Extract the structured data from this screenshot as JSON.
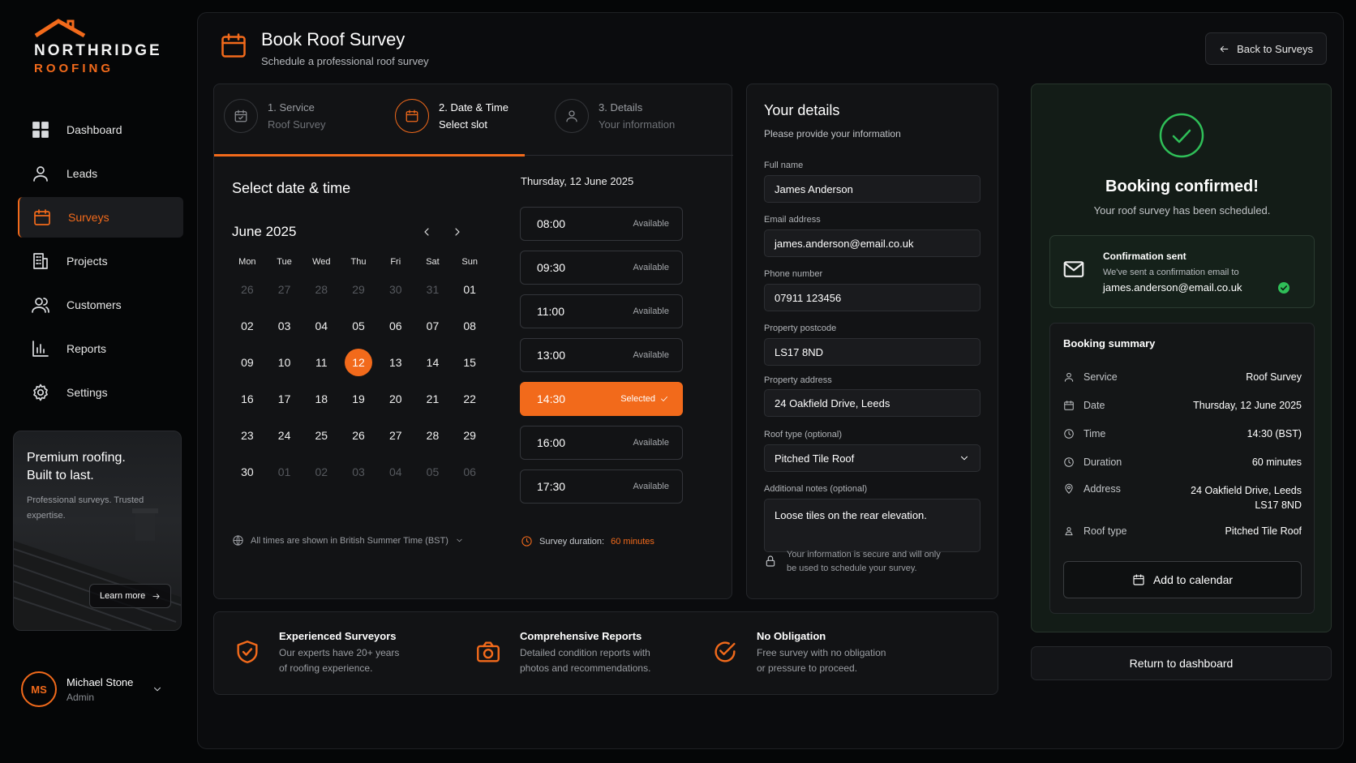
{
  "brand": {
    "name_line1": "NORTHRIDGE",
    "name_line2": "ROOFING"
  },
  "nav": [
    {
      "label": "Dashboard",
      "icon": "grid-icon"
    },
    {
      "label": "Leads",
      "icon": "user-icon"
    },
    {
      "label": "Surveys",
      "icon": "calendar-icon",
      "active": true
    },
    {
      "label": "Projects",
      "icon": "building-icon"
    },
    {
      "label": "Customers",
      "icon": "users-icon"
    },
    {
      "label": "Reports",
      "icon": "bar-chart-icon"
    },
    {
      "label": "Settings",
      "icon": "gear-icon"
    }
  ],
  "promo": {
    "heading": "Premium roofing. Built to last.",
    "text": "Professional surveys. Trusted expertise.",
    "button": "Learn more"
  },
  "user": {
    "initials": "MS",
    "name": "Michael Stone",
    "role": "Admin"
  },
  "header": {
    "title": "Book Roof Survey",
    "subtitle": "Schedule a professional roof survey",
    "back": "Back to Surveys"
  },
  "steps": [
    {
      "title": "1. Service",
      "sub": "Roof Survey"
    },
    {
      "title": "2. Date & Time",
      "sub": "Select slot",
      "active": true
    },
    {
      "title": "3. Details",
      "sub": "Your information"
    }
  ],
  "calendar": {
    "heading": "Select date & time",
    "month": "June 2025",
    "weekdays": [
      "Mon",
      "Tue",
      "Wed",
      "Thu",
      "Fri",
      "Sat",
      "Sun"
    ],
    "weeks": [
      [
        "26",
        "27",
        "28",
        "29",
        "30",
        "31",
        "01"
      ],
      [
        "02",
        "03",
        "04",
        "05",
        "06",
        "07",
        "08"
      ],
      [
        "09",
        "10",
        "11",
        "12",
        "13",
        "14",
        "15"
      ],
      [
        "16",
        "17",
        "18",
        "19",
        "20",
        "21",
        "22"
      ],
      [
        "23",
        "24",
        "25",
        "26",
        "27",
        "28",
        "29"
      ],
      [
        "30",
        "01",
        "02",
        "03",
        "04",
        "05",
        "06"
      ]
    ],
    "muted_first_row": 6,
    "muted_last_row_from": 1,
    "selected": "12",
    "timezone_note": "All times are shown in British Summer Time (BST)"
  },
  "slots": {
    "date_label": "Thursday, 12 June 2025",
    "items": [
      {
        "time": "08:00",
        "status": "Available"
      },
      {
        "time": "09:30",
        "status": "Available"
      },
      {
        "time": "11:00",
        "status": "Available"
      },
      {
        "time": "13:00",
        "status": "Available"
      },
      {
        "time": "14:30",
        "status": "Selected",
        "selected": true
      },
      {
        "time": "16:00",
        "status": "Available"
      },
      {
        "time": "17:30",
        "status": "Available"
      }
    ],
    "duration_label": "Survey duration:",
    "duration_value": "60 minutes"
  },
  "details": {
    "title": "Your details",
    "subtitle": "Please provide your information",
    "full_name_label": "Full name",
    "full_name": "James Anderson",
    "email_label": "Email address",
    "email": "james.anderson@email.co.uk",
    "phone_label": "Phone number",
    "phone": "07911 123456",
    "postcode_label": "Property postcode",
    "postcode": "LS17 8ND",
    "address_label": "Property address",
    "address": "24 Oakfield Drive, Leeds",
    "roof_label": "Roof type (optional)",
    "roof": "Pitched Tile Roof",
    "notes_label": "Additional notes (optional)",
    "notes": "Loose tiles on the rear elevation.",
    "secure_line1": "Your information is secure and will only",
    "secure_line2": "be used to schedule your survey."
  },
  "confirmation": {
    "title": "Booking confirmed!",
    "subtitle": "Your roof survey has been scheduled.",
    "sent_title": "Confirmation sent",
    "sent_text": "We've sent a confirmation email to",
    "sent_email": "james.anderson@email.co.uk",
    "summary_title": "Booking summary",
    "summary": {
      "service_k": "Service",
      "service_v": "Roof Survey",
      "date_k": "Date",
      "date_v": "Thursday, 12 June 2025",
      "time_k": "Time",
      "time_v": "14:30 (BST)",
      "duration_k": "Duration",
      "duration_v": "60 minutes",
      "address_k": "Address",
      "address_v1": "24 Oakfield Drive, Leeds",
      "address_v2": "LS17 8ND",
      "roof_k": "Roof type",
      "roof_v": "Pitched Tile Roof"
    },
    "add_calendar": "Add to calendar",
    "return": "Return to dashboard",
    "success_color": "#2fbf58"
  },
  "features": [
    {
      "title": "Experienced Surveyors",
      "line1": "Our experts have 20+ years",
      "line2": "of roofing experience.",
      "icon": "shield-check-icon"
    },
    {
      "title": "Comprehensive Reports",
      "line1": "Detailed condition reports with",
      "line2": "photos and recommendations.",
      "icon": "camera-icon"
    },
    {
      "title": "No Obligation",
      "line1": "Free survey with no obligation",
      "line2": "or pressure to proceed.",
      "icon": "check-circle-icon"
    }
  ],
  "colors": {
    "accent": "#f26a1b",
    "background": "#050607",
    "panel": "#121315"
  }
}
